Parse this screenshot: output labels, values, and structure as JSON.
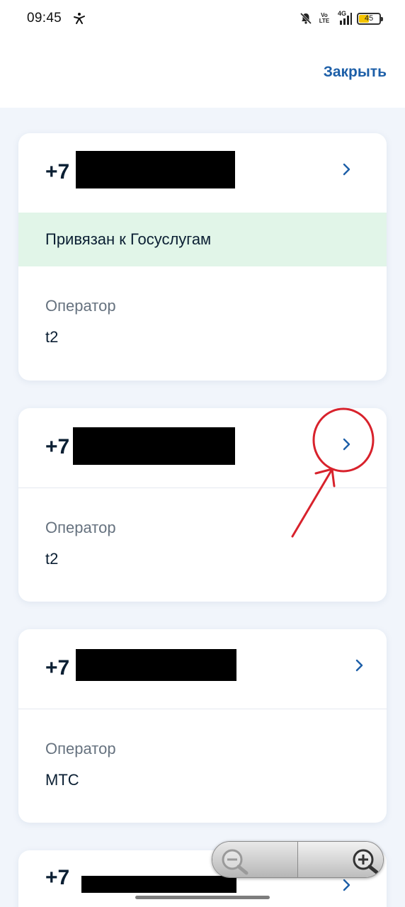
{
  "status_bar": {
    "time": "09:45",
    "volte_line1": "Vo",
    "volte_line2": "LTE",
    "network": "4G",
    "battery": "45",
    "icons": [
      "running-figure-icon",
      "bell-muted-icon",
      "signal-icon",
      "battery-icon"
    ]
  },
  "header": {
    "close_label": "Закрыть"
  },
  "cards": [
    {
      "phone_prefix": "+7",
      "linked_text": "Привязан к Госуслугам",
      "operator_label": "Оператор",
      "operator_value": "t2"
    },
    {
      "phone_prefix": "+7",
      "operator_label": "Оператор",
      "operator_value": "t2"
    },
    {
      "phone_prefix": "+7",
      "operator_label": "Оператор",
      "operator_value": "МТС"
    },
    {
      "phone_prefix": "+7"
    }
  ],
  "colors": {
    "accent": "#1d5fa8",
    "linked_bg": "#e1f5e8",
    "page_bg": "#f1f5fb",
    "annotation": "#d8222c"
  },
  "zoom": {
    "icons": [
      "zoom-out-icon",
      "zoom-in-icon"
    ]
  }
}
